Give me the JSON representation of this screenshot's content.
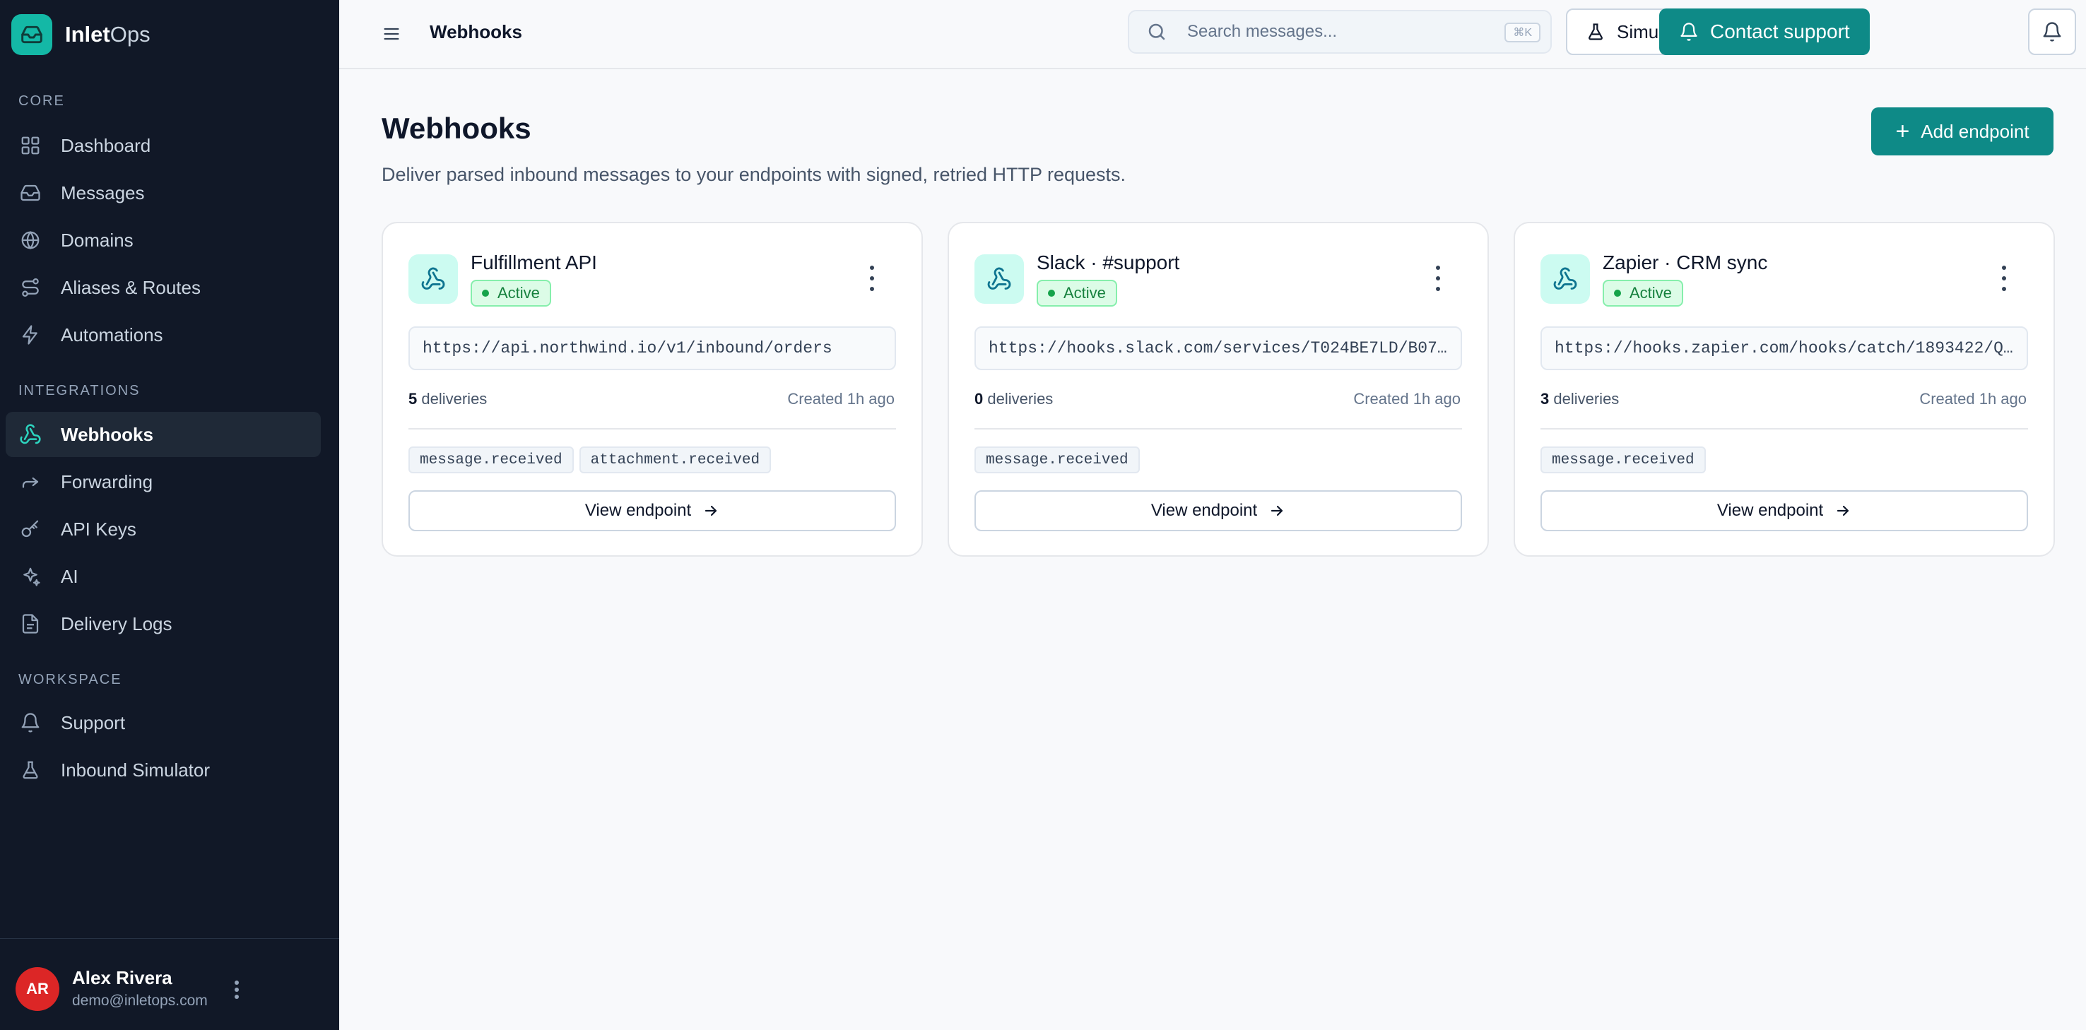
{
  "brand": {
    "name_bold": "Inlet",
    "name_light": "Ops"
  },
  "sidebar": {
    "sections": [
      {
        "label": "CORE"
      },
      {
        "label": "INTEGRATIONS"
      },
      {
        "label": "WORKSPACE"
      }
    ],
    "items": [
      {
        "label": "Dashboard",
        "icon": "dashboard-icon"
      },
      {
        "label": "Messages",
        "icon": "inbox-icon"
      },
      {
        "label": "Domains",
        "icon": "globe-icon"
      },
      {
        "label": "Aliases & Routes",
        "icon": "route-icon"
      },
      {
        "label": "Automations",
        "icon": "bolt-icon"
      },
      {
        "label": "Webhooks",
        "icon": "webhook-icon",
        "active": true
      },
      {
        "label": "Forwarding",
        "icon": "forward-icon"
      },
      {
        "label": "API Keys",
        "icon": "key-icon"
      },
      {
        "label": "AI",
        "icon": "sparkles-icon"
      },
      {
        "label": "Delivery Logs",
        "icon": "file-icon"
      },
      {
        "label": "Support",
        "icon": "bell-icon"
      },
      {
        "label": "Inbound Simulator",
        "icon": "flask-icon"
      }
    ],
    "user": {
      "initials": "AR",
      "name": "Alex Rivera",
      "email": "demo@inletops.com"
    }
  },
  "topbar": {
    "title": "Webhooks",
    "search_placeholder": "Search messages...",
    "search_shortcut": "⌘K",
    "simulate_label": "Simulate inbound",
    "support_label": "Contact support"
  },
  "main": {
    "title": "Webhooks",
    "subtitle": "Deliver parsed inbound messages to your endpoints with signed, retried HTTP requests.",
    "add_label": "Add endpoint",
    "cards": [
      {
        "name": "Fulfillment API",
        "status": "Active",
        "url": "https://api.northwind.io/v1/inbound/orders",
        "deliveries_count": "5",
        "deliveries_label": "deliveries",
        "created": "Created 1h ago",
        "tags": [
          "message.received",
          "attachment.received"
        ],
        "view_label": "View endpoint"
      },
      {
        "name": "Slack · #support",
        "status": "Active",
        "url": "https://hooks.slack.com/services/T024BE7LD/B07...",
        "deliveries_count": "0",
        "deliveries_label": "deliveries",
        "created": "Created 1h ago",
        "tags": [
          "message.received"
        ],
        "view_label": "View endpoint"
      },
      {
        "name": "Zapier · CRM sync",
        "status": "Active",
        "url": "https://hooks.zapier.com/hooks/catch/1893422/Q...",
        "deliveries_count": "3",
        "deliveries_label": "deliveries",
        "created": "Created 1h ago",
        "tags": [
          "message.received"
        ],
        "view_label": "View endpoint"
      }
    ]
  },
  "colors": {
    "accent": "#0e8a87",
    "sidebar_bg": "#111827",
    "active_green": "#16a34a"
  }
}
